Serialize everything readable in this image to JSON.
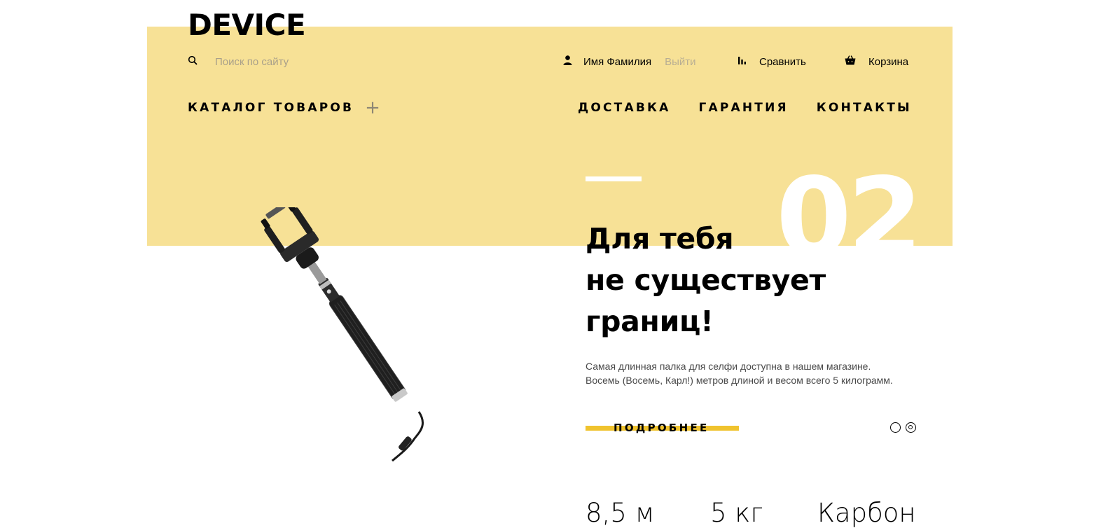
{
  "header": {
    "logo": "DEVICE",
    "search": {
      "placeholder": "Поиск по сайту",
      "icon": "search-icon"
    },
    "user": {
      "name": "Имя Фамилия",
      "logout": "Выйти",
      "icon": "user-icon"
    },
    "compare": {
      "label": "Сравнить",
      "icon": "bar-chart-icon"
    },
    "cart": {
      "label": "Корзина",
      "icon": "shopping-bag-icon"
    }
  },
  "nav": {
    "catalog": "КАТАЛОГ ТОВАРОВ",
    "catalog_toggle": "+",
    "links": [
      "ДОСТАВКА",
      "ГАРАНТИЯ",
      "КОНТАКТЫ"
    ]
  },
  "slider": {
    "number": "02",
    "title_lines": [
      "Для тебя",
      "не существует",
      "границ!"
    ],
    "description_lines": [
      "Самая длинная палка для селфи доступна в нашем магазине.",
      "Восемь (Восемь, Карл!) метров длиной и весом всего 5 килограмм."
    ],
    "more_button": "ПОДРОБНЕЕ",
    "active_slide_index": 2,
    "slide_count": 2,
    "image": "selfie-stick-image"
  },
  "specs": [
    "8,5 м",
    "5 кг",
    "Карбон"
  ],
  "colors": {
    "band": "#f7e196",
    "accent": "#f0c32e",
    "muted_text": "#b8ae93"
  }
}
